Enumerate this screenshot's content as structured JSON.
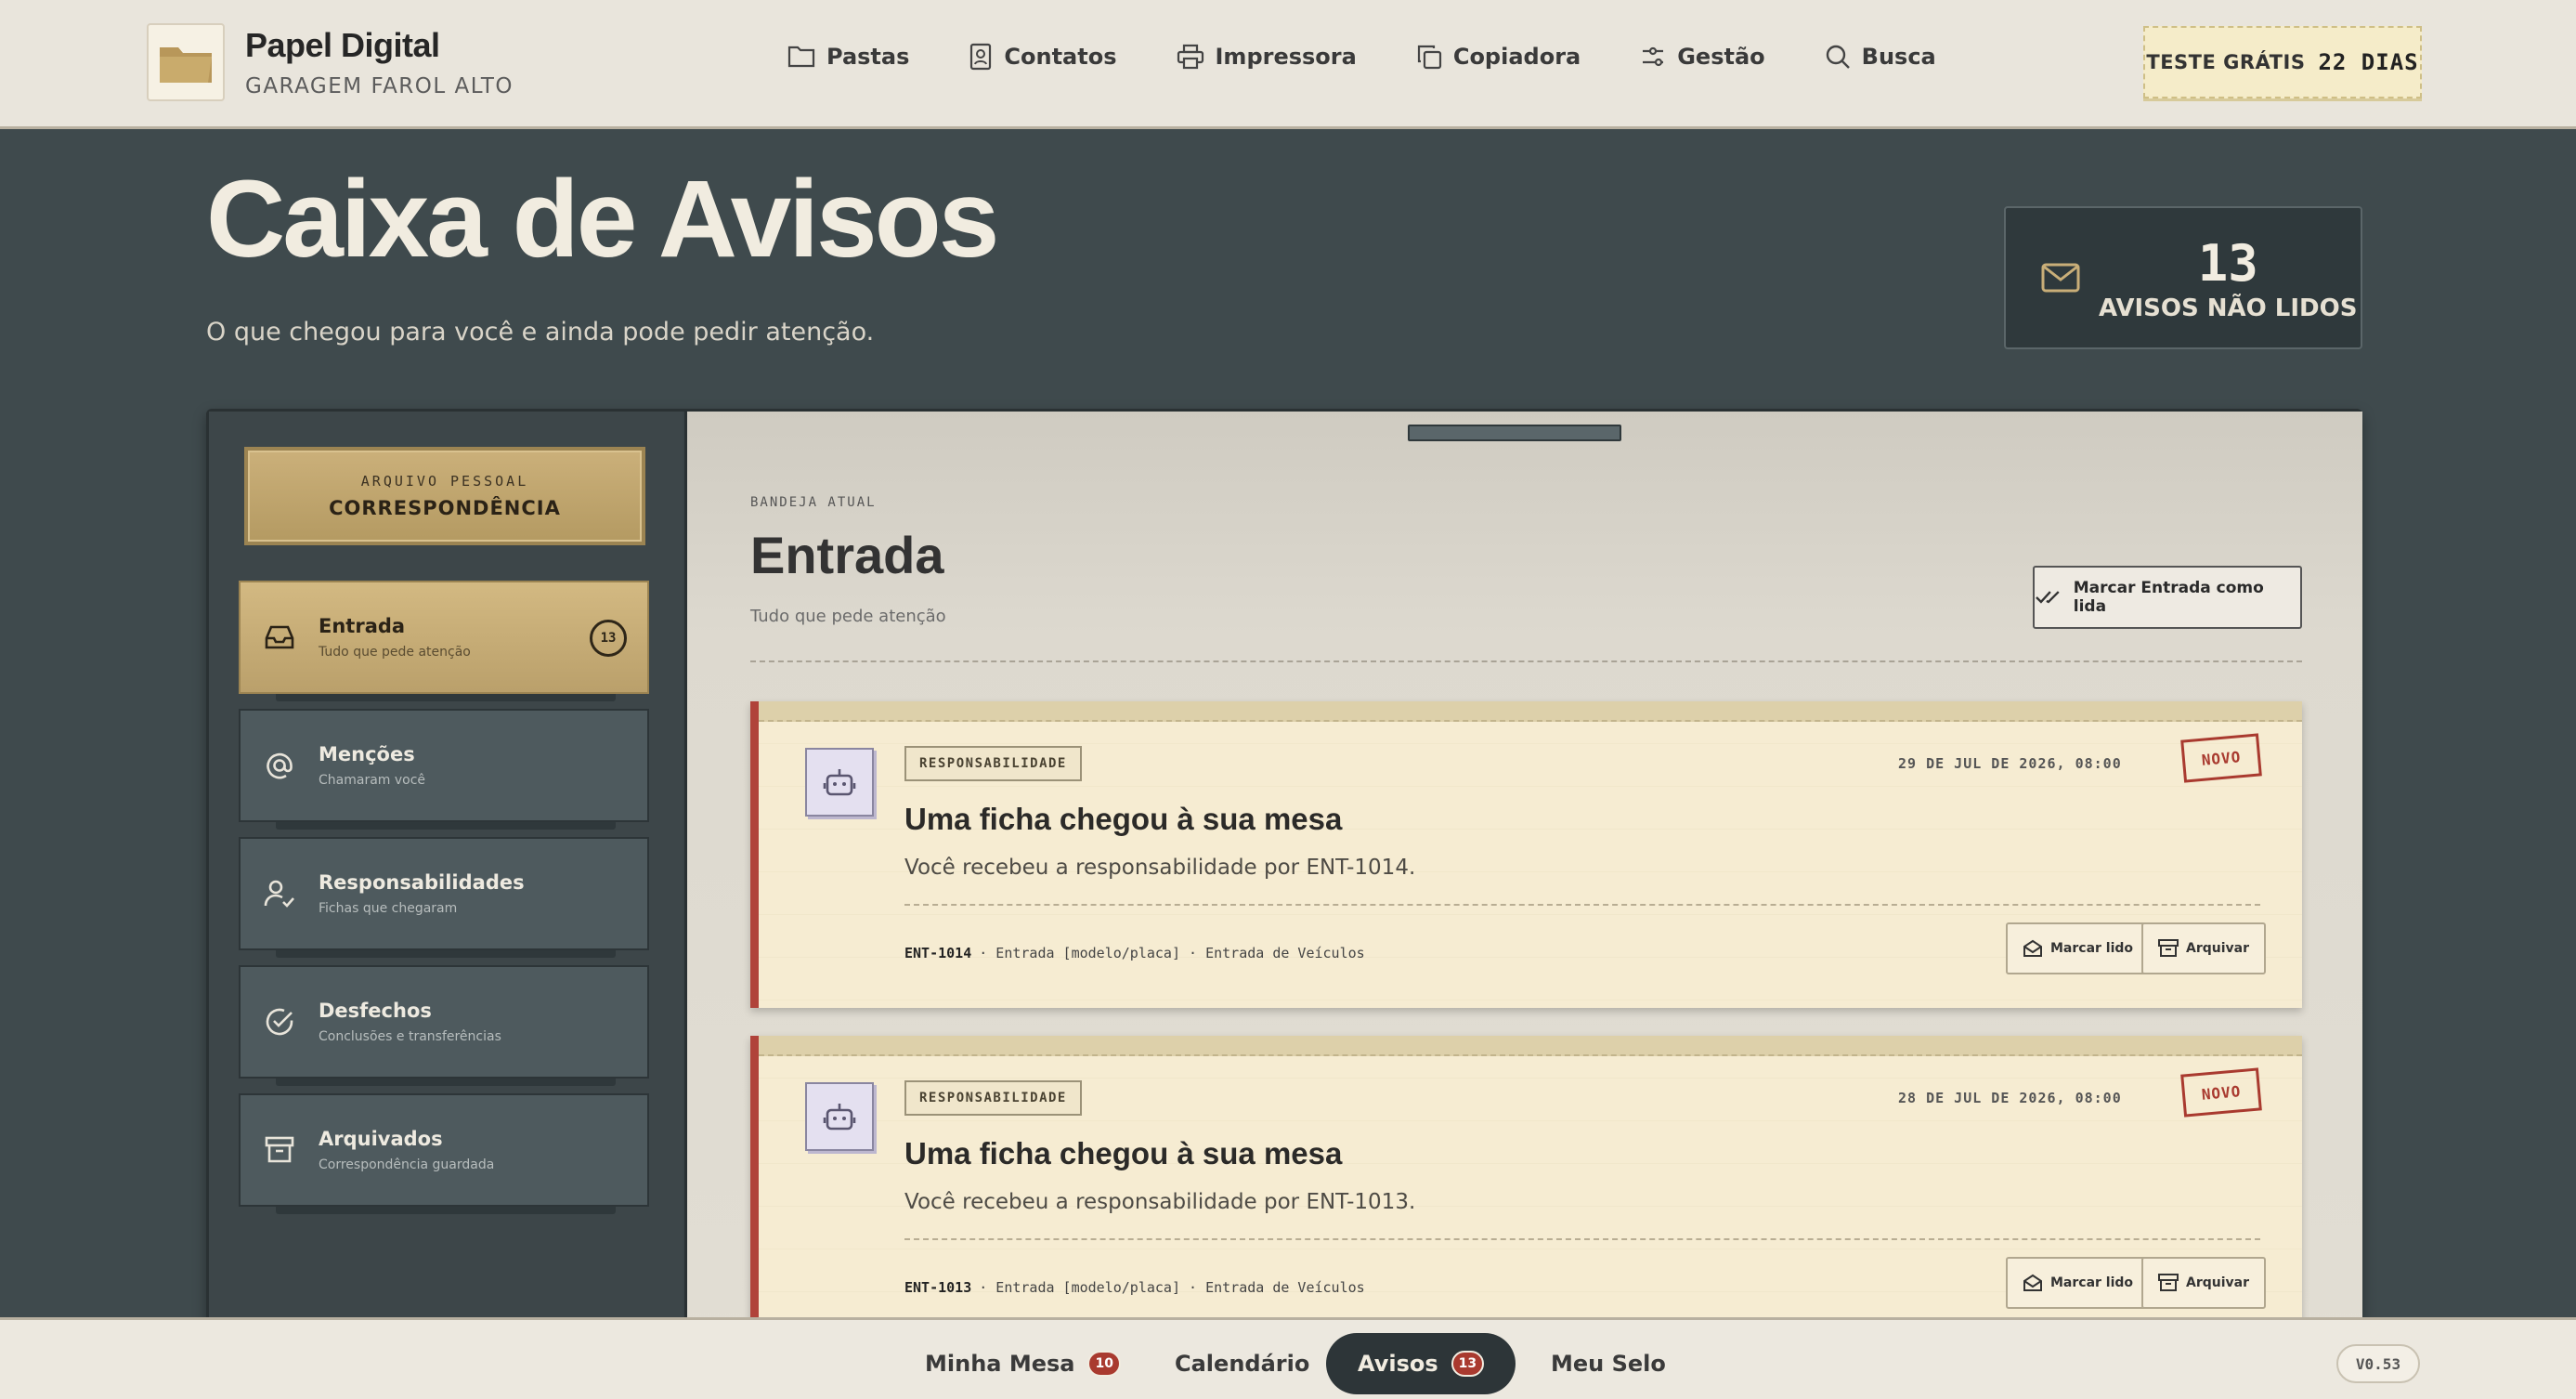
{
  "brand": {
    "name": "Papel Digital",
    "subtitle": "GARAGEM FAROL ALTO"
  },
  "nav": [
    {
      "label": "Pastas",
      "icon": "folder-icon"
    },
    {
      "label": "Contatos",
      "icon": "contact-icon"
    },
    {
      "label": "Impressora",
      "icon": "printer-icon"
    },
    {
      "label": "Copiadora",
      "icon": "copy-icon"
    },
    {
      "label": "Gestão",
      "icon": "sliders-icon"
    },
    {
      "label": "Busca",
      "icon": "search-icon"
    }
  ],
  "trial": {
    "label": "TESTE GRÁTIS",
    "days": "22 DIAS"
  },
  "hero": {
    "title": "Caixa de Avisos",
    "subtitle": "O que chegou para você e ainda pode pedir atenção.",
    "unread_count": "13",
    "unread_label": "AVISOS NÃO LIDOS"
  },
  "sidebar": {
    "plaque_kicker": "ARQUIVO PESSOAL",
    "plaque_title": "CORRESPONDÊNCIA",
    "folders": [
      {
        "name": "Entrada",
        "desc": "Tudo que pede atenção",
        "badge": "13",
        "icon": "inbox-icon"
      },
      {
        "name": "Menções",
        "desc": "Chamaram você",
        "icon": "at-icon"
      },
      {
        "name": "Responsabilidades",
        "desc": "Fichas que chegaram",
        "icon": "user-check-icon"
      },
      {
        "name": "Desfechos",
        "desc": "Conclusões e transferências",
        "icon": "check-circle-icon"
      },
      {
        "name": "Arquivados",
        "desc": "Correspondência guardada",
        "icon": "archive-icon"
      }
    ]
  },
  "tray": {
    "kicker": "BANDEJA ATUAL",
    "title": "Entrada",
    "subtitle": "Tudo que pede atenção",
    "mark_all": "Marcar Entrada como lida"
  },
  "notices": [
    {
      "tag": "RESPONSABILIDADE",
      "date": "29 DE JUL DE 2026, 08:00",
      "stamp": "NOVO",
      "title": "Uma ficha chegou à sua mesa",
      "desc": "Você recebeu a responsabilidade por ENT-1014.",
      "code": "ENT-1014",
      "meta": "· Entrada [modelo/placa] · Entrada de Veículos",
      "mark_read": "Marcar lido",
      "archive": "Arquivar"
    },
    {
      "tag": "RESPONSABILIDADE",
      "date": "28 DE JUL DE 2026, 08:00",
      "stamp": "NOVO",
      "title": "Uma ficha chegou à sua mesa",
      "desc": "Você recebeu a responsabilidade por ENT-1013.",
      "code": "ENT-1013",
      "meta": "· Entrada [modelo/placa] · Entrada de Veículos",
      "mark_read": "Marcar lido",
      "archive": "Arquivar"
    }
  ],
  "bottom": {
    "tabs": [
      {
        "label": "Minha Mesa",
        "badge": "10"
      },
      {
        "label": "Calendário"
      },
      {
        "label": "Avisos",
        "badge": "13",
        "active": true
      },
      {
        "label": "Meu Selo"
      }
    ],
    "version": "V0.53"
  },
  "colors": {
    "accent_red": "#a93a2f",
    "gold": "#c9ae78",
    "slate": "#3f4a4d",
    "paper": "#f6ecd2"
  }
}
